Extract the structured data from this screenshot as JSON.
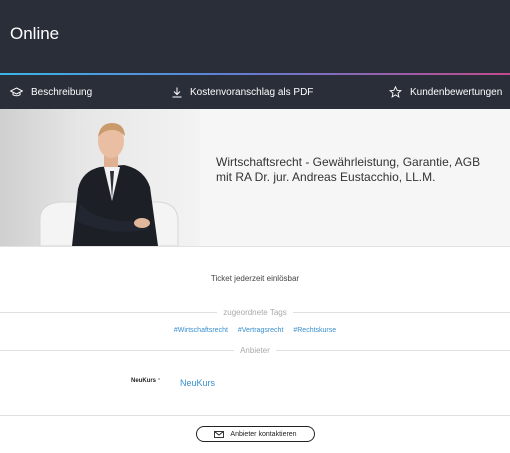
{
  "header": {
    "title": "Online"
  },
  "nav": {
    "items": [
      {
        "label": "Beschreibung",
        "icon": "graduation-cap-icon"
      },
      {
        "label": "Kostenvoranschlag als PDF",
        "icon": "download-icon"
      },
      {
        "label": "Kundenbewertungen",
        "icon": "star-icon"
      }
    ]
  },
  "course": {
    "title": "Wirtschaftsrecht - Gewährleistung, Garantie, AGB mit RA Dr. jur. Andreas Eustacchio, LL.M.",
    "ticket_note": "Ticket jederzeit einlösbar"
  },
  "tags": {
    "heading": "zugeordnete Tags",
    "items": [
      "#Wirtschaftsrecht",
      "#Vertragsrecht",
      "#Rechtskurse"
    ]
  },
  "provider": {
    "heading": "Anbieter",
    "logo_text": "NeuKurs",
    "name": "NeuKurs"
  },
  "contact_button": {
    "label": "Anbieter kontaktieren",
    "icon": "mail-icon"
  },
  "colors": {
    "header_bg": "#2a2e38",
    "link": "#3a8fcf",
    "accent_gradient": [
      "#3ab6e8",
      "#c24a8c"
    ]
  }
}
